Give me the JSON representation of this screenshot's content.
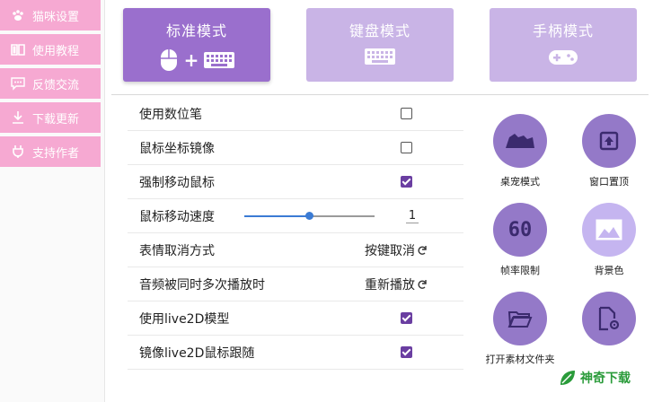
{
  "sidebar": {
    "items": [
      {
        "label": "猫咪设置",
        "icon": "paw-icon"
      },
      {
        "label": "使用教程",
        "icon": "book-icon"
      },
      {
        "label": "反馈交流",
        "icon": "chat-icon"
      },
      {
        "label": "下载更新",
        "icon": "download-icon"
      },
      {
        "label": "支持作者",
        "icon": "support-icon"
      }
    ]
  },
  "modes": [
    {
      "label": "标准模式",
      "active": true,
      "icons": [
        "mouse-icon",
        "keyboard-icon"
      ]
    },
    {
      "label": "键盘模式",
      "active": false,
      "icons": [
        "keyboard-icon"
      ]
    },
    {
      "label": "手柄模式",
      "active": false,
      "icons": [
        "gamepad-icon"
      ]
    }
  ],
  "settings": {
    "rows": [
      {
        "label": "使用数位笔",
        "type": "checkbox",
        "checked": false
      },
      {
        "label": "鼠标坐标镜像",
        "type": "checkbox",
        "checked": false
      },
      {
        "label": "强制移动鼠标",
        "type": "checkbox",
        "checked": true
      },
      {
        "label": "鼠标移动速度",
        "type": "slider",
        "value": "1",
        "fraction": 0.5
      },
      {
        "label": "表情取消方式",
        "type": "option",
        "value": "按键取消"
      },
      {
        "label": "音频被同时多次播放时",
        "type": "option",
        "value": "重新播放"
      },
      {
        "label": "使用live2D模型",
        "type": "checkbox",
        "checked": true
      },
      {
        "label": "镜像live2D鼠标跟随",
        "type": "checkbox",
        "checked": true
      }
    ]
  },
  "functions": [
    {
      "label": "桌宠模式",
      "icon": "desk-pet-icon",
      "style": "dark"
    },
    {
      "label": "窗口置顶",
      "icon": "pin-top-icon",
      "style": "dark"
    },
    {
      "label": "帧率限制",
      "icon": "fps-60-icon",
      "text": "60",
      "style": "dark"
    },
    {
      "label": "背景色",
      "icon": "image-icon",
      "style": "light"
    },
    {
      "label": "打开素材文件夹",
      "icon": "folder-open-icon",
      "style": "dark"
    },
    {
      "label": "",
      "icon": "file-settings-icon",
      "style": "dark"
    }
  ],
  "watermark": {
    "text": "神奇下载"
  },
  "colors": {
    "sidebar_pink": "#f6a9d2",
    "mode_active": "#9a6fcd",
    "mode_inactive": "#c9b4e6",
    "accent_purple": "#6a3ea1",
    "circle_dark": "#9479c8",
    "circle_light": "#c5b5f0",
    "slider_blue": "#3b7bd4"
  }
}
